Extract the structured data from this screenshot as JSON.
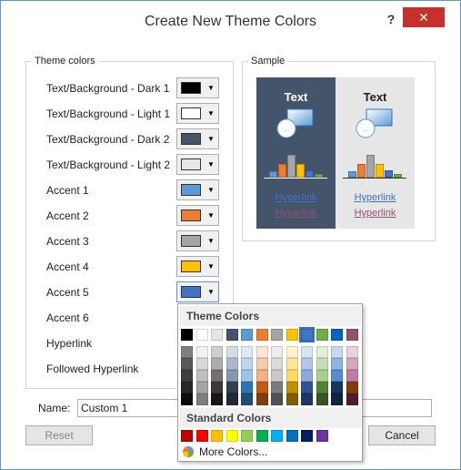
{
  "dialog": {
    "title": "Create New Theme Colors",
    "help_label": "?",
    "close_label": "✕"
  },
  "theme_colors": {
    "legend": "Theme colors",
    "rows": [
      {
        "label": "Text/Background - Dark 1",
        "color": "#000000"
      },
      {
        "label": "Text/Background - Light 1",
        "color": "#ffffff"
      },
      {
        "label": "Text/Background - Dark 2",
        "color": "#44546a"
      },
      {
        "label": "Text/Background - Light 2",
        "color": "#e7e6e6"
      },
      {
        "label": "Accent 1",
        "color": "#5b9bd5"
      },
      {
        "label": "Accent 2",
        "color": "#ed7d31"
      },
      {
        "label": "Accent 3",
        "color": "#a5a5a5"
      },
      {
        "label": "Accent 4",
        "color": "#ffc000"
      },
      {
        "label": "Accent 5",
        "color": "#4472c4"
      },
      {
        "label": "Accent 6",
        "color": ""
      },
      {
        "label": "Hyperlink",
        "color": ""
      },
      {
        "label": "Followed Hyperlink",
        "color": ""
      }
    ]
  },
  "sample": {
    "legend": "Sample",
    "dark_text": "Text",
    "light_text": "Text",
    "hyperlink": "Hyperlink",
    "followed_hyperlink": "Hyperlink",
    "hyperlink_color": "#4472c4",
    "followed_color": "#954f72"
  },
  "name_field": {
    "label": "Name:",
    "value": "Custom 1"
  },
  "buttons": {
    "reset": "Reset",
    "cancel": "Cancel"
  },
  "popup": {
    "theme_header": "Theme Colors",
    "standard_header": "Standard Colors",
    "more_colors": "More Colors...",
    "theme_row": [
      "#000000",
      "#ffffff",
      "#e7e6e6",
      "#44546a",
      "#5b9bd5",
      "#ed7d31",
      "#a5a5a5",
      "#ffc000",
      "#4472c4",
      "#70ad47",
      "#0563c1",
      "#954f72"
    ],
    "shade_rows": [
      [
        "#7f7f7f",
        "#f2f2f2",
        "#d0cece",
        "#d6dce4",
        "#deebf6",
        "#fbe5d5",
        "#ededed",
        "#fff2cc",
        "#dae3f3",
        "#e2efd9",
        "#c5d9f1",
        "#ead1dc"
      ],
      [
        "#595959",
        "#d8d8d8",
        "#aeabab",
        "#adb9ca",
        "#bdd7ee",
        "#f7cbac",
        "#dbdbdb",
        "#fee599",
        "#b4c6e7",
        "#c5e0b3",
        "#8db3e2",
        "#d5a6bd"
      ],
      [
        "#3f3f3f",
        "#bfbfbf",
        "#757070",
        "#8496b0",
        "#9dc3e6",
        "#f4b183",
        "#c9c9c9",
        "#ffd965",
        "#8eaadb",
        "#a8d08d",
        "#548dd4",
        "#c27ba0"
      ],
      [
        "#262626",
        "#a5a5a5",
        "#3a3838",
        "#323f4f",
        "#2e75b5",
        "#c55a11",
        "#7b7b7b",
        "#bf9000",
        "#2f5496",
        "#538135",
        "#17365d",
        "#843c0c"
      ],
      [
        "#0c0c0c",
        "#7f7f7f",
        "#171616",
        "#222a35",
        "#1e4e79",
        "#833c0b",
        "#525252",
        "#7f6000",
        "#1f3864",
        "#375623",
        "#0f243e",
        "#521b33"
      ]
    ],
    "standard_row": [
      "#c00000",
      "#ff0000",
      "#ffc000",
      "#ffff00",
      "#92d050",
      "#00b050",
      "#00b0f0",
      "#0070c0",
      "#002060",
      "#7030a0"
    ]
  },
  "chart_bars": {
    "dark_colors": [
      "#5b9bd5",
      "#ed7d31",
      "#a5a5a5",
      "#ffc000",
      "#4472c4",
      "#70ad47"
    ],
    "heights": [
      0.25,
      0.55,
      0.9,
      0.55,
      0.3,
      0.15
    ]
  }
}
